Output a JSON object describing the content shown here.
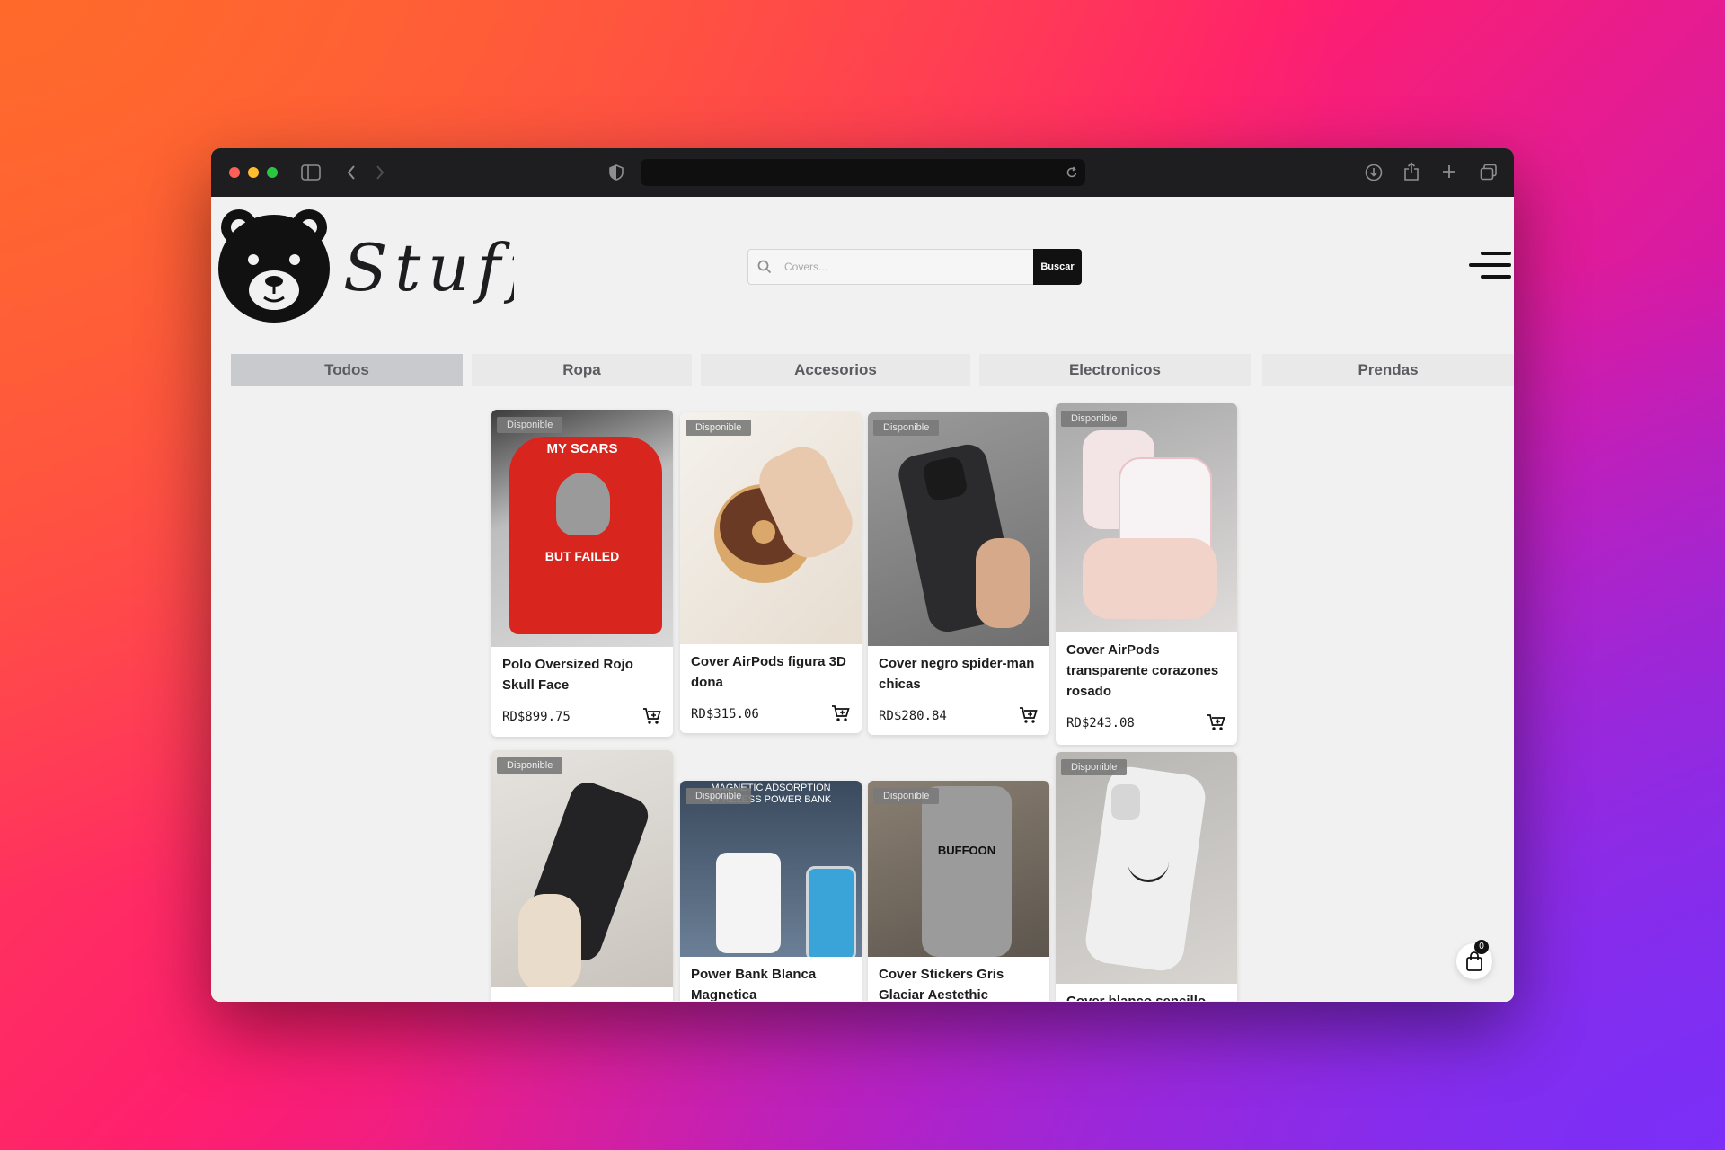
{
  "brand": {
    "name": "Stuff"
  },
  "search": {
    "placeholder": "Covers...",
    "button_label": "Buscar"
  },
  "tabs": [
    {
      "label": "Todos",
      "active": true
    },
    {
      "label": "Ropa",
      "active": false
    },
    {
      "label": "Accesorios",
      "active": false
    },
    {
      "label": "Electronicos",
      "active": false
    },
    {
      "label": "Prendas",
      "active": false
    }
  ],
  "products": [
    {
      "badge": "Disponible",
      "name": "Polo Oversized Rojo Skull Face",
      "price": "RD$899.75",
      "image_text_1": "MY SCARS",
      "image_text_2": "BUT FAILED"
    },
    {
      "badge": "Disponible",
      "name": "Cover AirPods figura 3D dona",
      "price": "RD$315.06"
    },
    {
      "badge": "Disponible",
      "name": "Cover negro spider-man chicas",
      "price": "RD$280.84"
    },
    {
      "badge": "Disponible",
      "name": "Cover AirPods transparente corazones rosado",
      "price": "RD$243.08"
    },
    {
      "badge": "Disponible",
      "name": "",
      "price": ""
    },
    {
      "badge": "Disponible",
      "name": "Power Bank Blanca Magnetica",
      "price": "",
      "image_text_1": "MAGNETIC ADSORPTION",
      "image_text_2": "WIRELESS POWER BANK"
    },
    {
      "badge": "Disponible",
      "name": "Cover Stickers Gris Glaciar Aestethic",
      "price": "",
      "image_text_1": "BUFFOON"
    },
    {
      "badge": "Disponible",
      "name": "Cover blanco sencillo",
      "price": ""
    }
  ],
  "cart": {
    "count": "0"
  },
  "colors": {
    "accent": "#111111",
    "tab_active": "#c9cacd",
    "tab_inactive": "#e9e9ea"
  }
}
